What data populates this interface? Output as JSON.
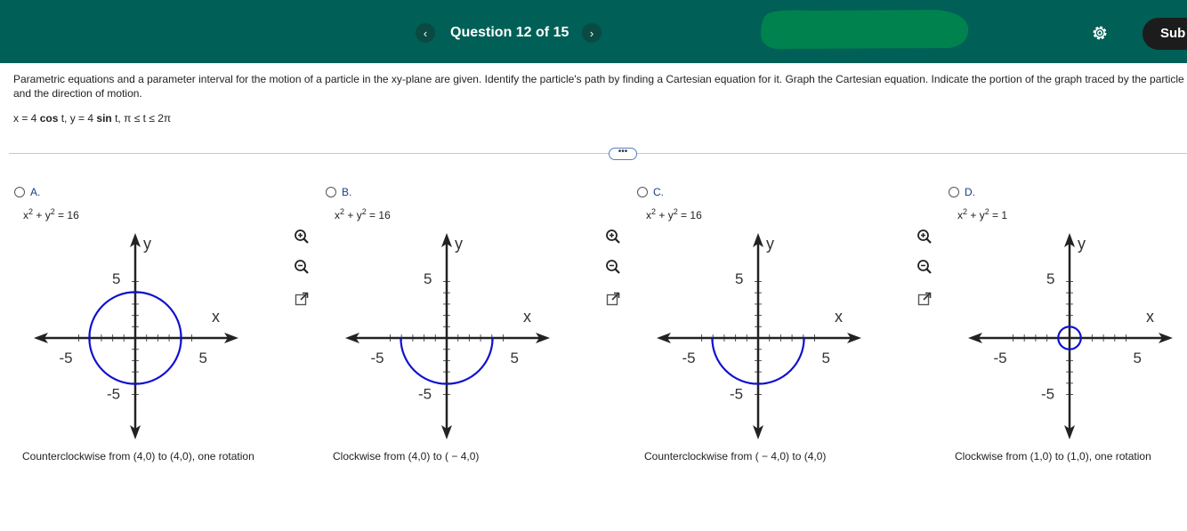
{
  "header": {
    "question_label": "Question 12 of 15",
    "prev_icon": "‹",
    "next_icon": "›",
    "submit_label": "Sub",
    "redaction_color": "#00824e",
    "settings_icon": "gear-icon"
  },
  "question": {
    "text": "Parametric equations and a parameter interval for the motion of a particle in the xy-plane are given. Identify the particle's path by finding a Cartesian equation for it. Graph the Cartesian equation. Indicate the portion of the graph traced by the particle and the direction of motion.",
    "eq_x": "x = 4",
    "eq_x_fn": "cos",
    "eq_x_var": " t,  y = 4",
    "eq_y_fn": "sin",
    "eq_interval": " t,  π ≤ t ≤ 2π"
  },
  "more_label": "•••",
  "options": [
    {
      "letter": "A.",
      "eq_base": "x",
      "eq_mid": " + y",
      "eq_rhs": " = 16",
      "caption": "Counterclockwise from (4,0) to (4,0), one rotation"
    },
    {
      "letter": "B.",
      "eq_base": "x",
      "eq_mid": " + y",
      "eq_rhs": " = 16",
      "caption": "Clockwise from (4,0) to ( − 4,0)"
    },
    {
      "letter": "C.",
      "eq_base": "x",
      "eq_mid": " + y",
      "eq_rhs": " = 16",
      "caption": "Counterclockwise from ( − 4,0) to (4,0)"
    },
    {
      "letter": "D.",
      "eq_base": "x",
      "eq_mid": " + y",
      "eq_rhs": " = 1",
      "caption": "Clockwise from (1,0) to (1,0), one rotation"
    }
  ],
  "exponent": "2",
  "graph_labels": {
    "y": "y",
    "x": "x",
    "pos": "5",
    "neg": "-5"
  },
  "colors": {
    "header": "#005f56",
    "curve": "#1010d0",
    "accent": "#1a3c8f"
  }
}
